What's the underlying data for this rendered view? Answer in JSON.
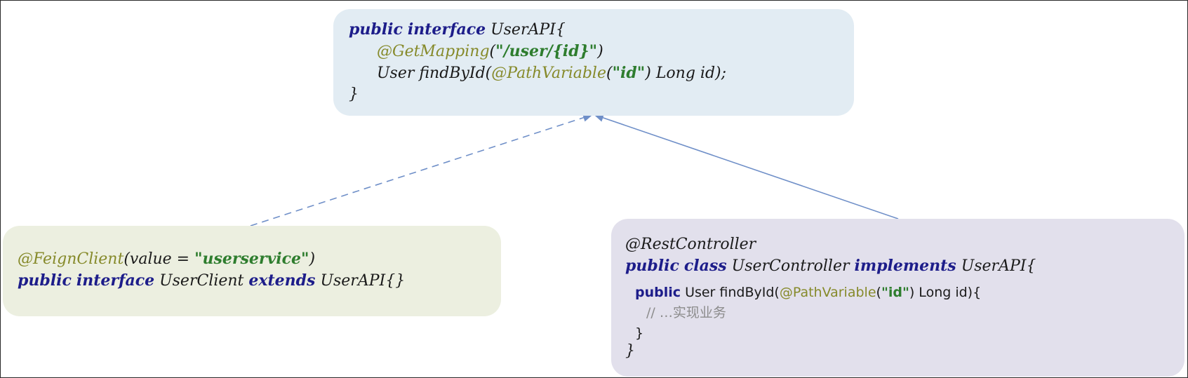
{
  "user_api": {
    "line1": {
      "kw1": "public",
      "kw2": "interface",
      "name": "UserAPI{"
    },
    "line2": {
      "anno": "@GetMapping",
      "open": "(",
      "str": "\"/user/{id}\"",
      "close": ")"
    },
    "line3": {
      "pre": "User findById(",
      "anno": "@PathVariable",
      "open": "(",
      "str": "\"id\"",
      "post": ") Long id);"
    },
    "line4": "}"
  },
  "user_client": {
    "line1": {
      "anno": "@FeignClient",
      "pre": "(value = ",
      "str": "\"userservice\"",
      "post": ")"
    },
    "line2": {
      "kw1": "public",
      "kw2": "interface",
      "name": "UserClient",
      "kw3": "extends",
      "parent": "UserAPI{}"
    }
  },
  "user_controller": {
    "line1": "@RestController",
    "line2": {
      "kw1": "public",
      "kw2": "class",
      "name": "UserController",
      "kw3": "implements",
      "parent": "UserAPI{"
    },
    "line3": {
      "kw": "public",
      "pre": "User findById(",
      "anno": "@PathVariable",
      "open": "(",
      "str": "\"id\"",
      "post": ") Long id){"
    },
    "line4": "// …实现业务",
    "line5": "}",
    "line6": "}"
  },
  "colors": {
    "api_box": "#e2ecf3",
    "client_box": "#ecefe0",
    "controller_box": "#e2e0ec",
    "arrow": "#6f8fc8",
    "keyword": "#1d1d8a",
    "annotation": "#868a2a",
    "string": "#2e7d2e"
  }
}
